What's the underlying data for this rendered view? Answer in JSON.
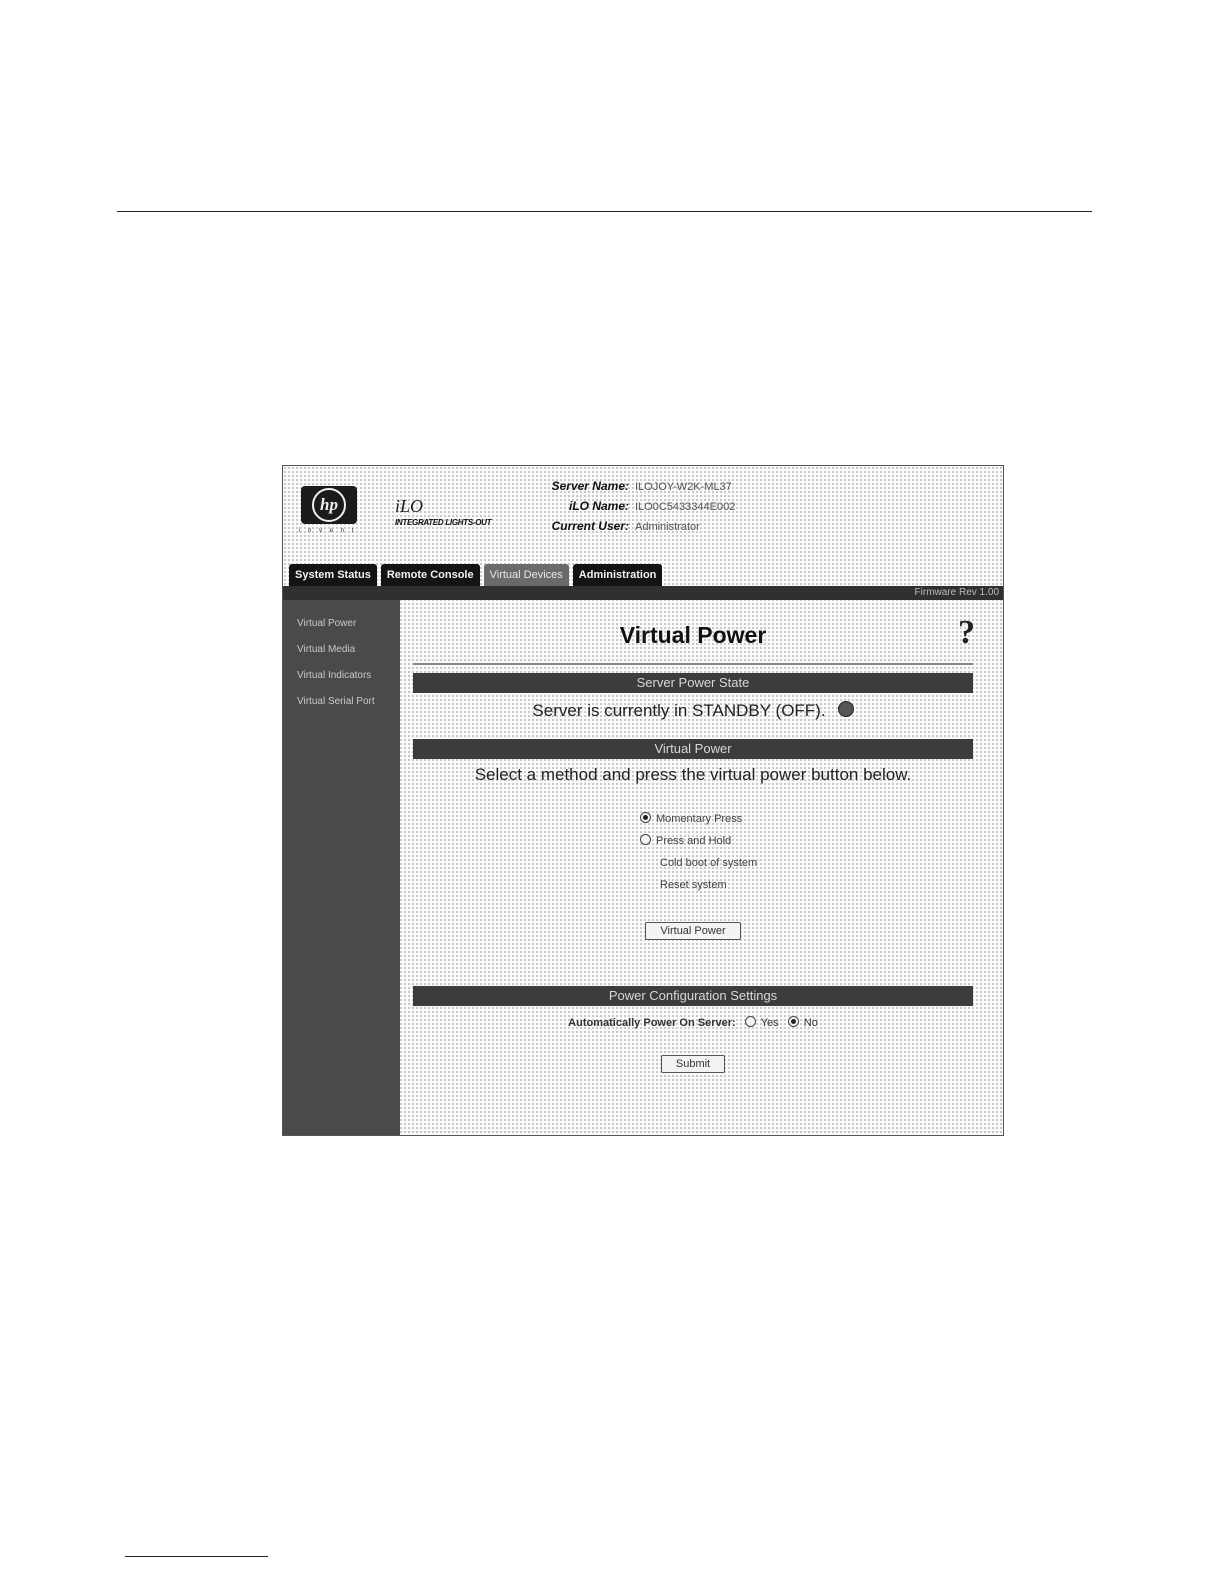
{
  "header": {
    "hp_logo_text": "hp",
    "hp_tagline": "i n v e n t",
    "product_name": "iLO",
    "product_subtitle": "INTEGRATED LIGHTS-OUT",
    "server_name_label": "Server Name:",
    "server_name_value": "ILOJOY-W2K-ML37",
    "ilo_name_label": "iLO Name:",
    "ilo_name_value": "ILO0C5433344E002",
    "current_user_label": "Current User:",
    "current_user_value": "Administrator"
  },
  "tabs": [
    {
      "label": "System Status"
    },
    {
      "label": "Remote Console"
    },
    {
      "label": "Virtual Devices"
    },
    {
      "label": "Administration"
    }
  ],
  "revision": "Firmware Rev 1.00",
  "sidebar": {
    "items": [
      {
        "label": "Virtual Power"
      },
      {
        "label": "Virtual Media"
      },
      {
        "label": "Virtual Indicators"
      },
      {
        "label": "Virtual Serial Port"
      }
    ]
  },
  "main": {
    "title": "Virtual Power",
    "help_glyph": "?",
    "server_power_state_header": "Server Power State",
    "server_power_state_text": "Server is currently in STANDBY (OFF).",
    "virtual_power_header": "Virtual Power",
    "instruction": "Select a method and press the virtual power button below.",
    "options": [
      {
        "label": "Momentary Press",
        "selected": true
      },
      {
        "label": "Press and Hold",
        "selected": false
      },
      {
        "label": "Cold boot of system",
        "selected": false
      },
      {
        "label": "Reset system",
        "selected": false
      }
    ],
    "virtual_power_button": "Virtual Power",
    "power_config_header": "Power Configuration Settings",
    "auto_power_label": "Automatically Power On Server:",
    "auto_power_yes": "Yes",
    "auto_power_no": "No",
    "submit_button": "Submit"
  }
}
